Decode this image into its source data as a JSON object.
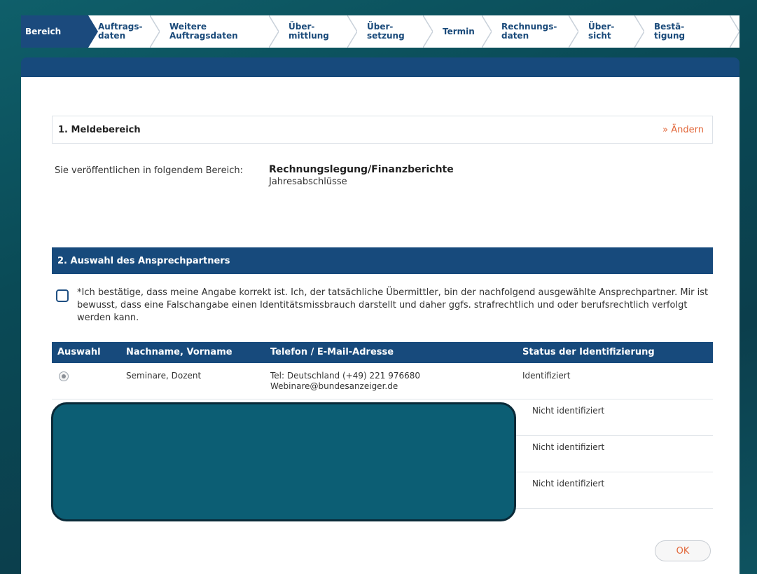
{
  "steps": [
    {
      "label": "Bereich",
      "active": true
    },
    {
      "label": "Auftrags-\ndaten"
    },
    {
      "label": "Weitere\nAuftragsdaten"
    },
    {
      "label": "Über-\nmittlung"
    },
    {
      "label": "Über-\nsetzung"
    },
    {
      "label": "Termin"
    },
    {
      "label": "Rechnungs-\ndaten"
    },
    {
      "label": "Über-\nsicht"
    },
    {
      "label": "Bestä-\ntigung"
    }
  ],
  "section1": {
    "title": "1. Meldebereich",
    "change_link": "» Ändern",
    "area_label": "Sie veröffentlichen in folgendem Bereich:",
    "area_main": "Rechnungslegung/Finanzberichte",
    "area_sub": "Jahresabschlüsse"
  },
  "section2": {
    "title": "2. Auswahl des Ansprechpartners",
    "confirm_text": "*Ich bestätige, dass meine Angabe korrekt ist. Ich, der tatsächliche Übermittler, bin der nachfolgend ausgewählte Ansprechpartner. Mir ist bewusst, dass eine Falschangabe einen Identitätsmissbrauch darstellt und daher ggfs. strafrechtlich und oder berufsrechtlich verfolgt werden kann."
  },
  "table": {
    "headers": {
      "select": "Auswahl",
      "name": "Nachname, Vorname",
      "contact": "Telefon / E-Mail-Adresse",
      "status": "Status der Identifizierung"
    },
    "rows": [
      {
        "name": "Seminare, Dozent",
        "phone": "Tel: Deutschland (+49) 221 976680",
        "email": "Webinare@bundesanzeiger.de",
        "status": "Identifiziert",
        "selected": true
      },
      {
        "name": "",
        "phone": "",
        "email": "",
        "status": "Nicht identifiziert"
      },
      {
        "name": "",
        "phone": "",
        "email": "",
        "status": "Nicht identifiziert"
      },
      {
        "name": "",
        "phone": "",
        "email": "",
        "status": "Nicht identifiziert"
      }
    ]
  },
  "ok_button": "OK",
  "colors": {
    "header_blue": "#174a7c",
    "link_orange": "#e2673a",
    "redaction": "#0c5e74",
    "background": "#0b3e4c"
  }
}
